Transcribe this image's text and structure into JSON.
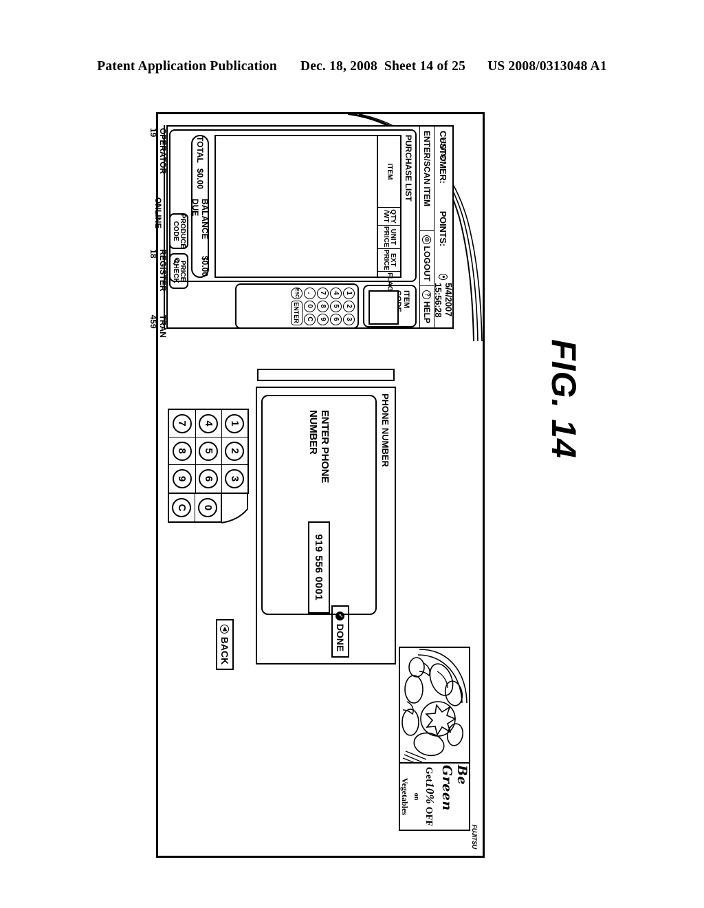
{
  "page_header": {
    "publication": "Patent Application Publication",
    "date": "Dec. 18, 2008",
    "sheet": "Sheet 14 of 25",
    "pub_number": "US 2008/0313048 A1"
  },
  "figure": {
    "label": "FIG. 14",
    "brand_logo": "FUJITSU"
  },
  "operator_screen": {
    "header": {
      "customer_label": "CUSTOMER:",
      "points_label": "POINTS:",
      "datetime": "5/4/2007 15:56:28",
      "clock_icon": "clock-icon",
      "logout_label": "LOGOUT",
      "logout_icon": "power-icon",
      "help_label": "HELP",
      "help_icon": "question-mark-icon"
    },
    "enter_scan_label": "ENTER/SCAN ITEM",
    "purchase_list": {
      "title": "PURCHASE LIST",
      "columns": [
        "ITEM",
        "QTY /WT",
        "UNIT PRICE",
        "EXT PRICE",
        "FLAGS"
      ],
      "rows": []
    },
    "totals": {
      "total_label": "TOTAL",
      "total_value": "$0.00",
      "balance_label": "BALANCE DUE",
      "balance_value": "$0.00"
    },
    "action_buttons": [
      {
        "name": "produce-code-button",
        "line1": "PRODUCE",
        "line2": "CODE",
        "icon": ""
      },
      {
        "name": "price-check-button",
        "line1": "PRICE",
        "line2": "CHECK",
        "icon": "magnifier-icon"
      }
    ],
    "item_code": {
      "label": "ITEM CODE",
      "value": "",
      "placeholder": ""
    },
    "keypad": {
      "rows": [
        [
          "1",
          "2",
          "3"
        ],
        [
          "4",
          "5",
          "6"
        ],
        [
          "7",
          "8",
          "9"
        ],
        [
          ".",
          "0",
          "C"
        ]
      ],
      "esc_label": "ESC",
      "enter_label": "ENTER"
    },
    "status_bar": {
      "operator": "OPERATOR 19",
      "connection": "ONLINE",
      "register": "REGISTER 18",
      "transaction": "TRAN 459"
    }
  },
  "customer_display": {
    "advertisement": {
      "brand": "Be Green",
      "offer_prefix": "Get",
      "offer_percent": "10%",
      "offer_suffix": "OFF",
      "offer_on": "on",
      "offer_item": "Vegetables",
      "image_alt": "vegetables-illustration"
    },
    "phone_panel": {
      "title": "PHONE NUMBER",
      "field_label": "ENTER PHONE NUMBER",
      "field_value": "919 556 0001",
      "done_label": "DONE",
      "done_icon": "check-circle-icon"
    },
    "back_button": {
      "label": "BACK",
      "icon": "back-chevron-icon"
    },
    "keypad": {
      "grid": [
        [
          "1",
          "2",
          "3"
        ],
        [
          "4",
          "5",
          "6"
        ],
        [
          "7",
          "8",
          "9"
        ]
      ],
      "side": [
        "C",
        "0"
      ]
    }
  }
}
